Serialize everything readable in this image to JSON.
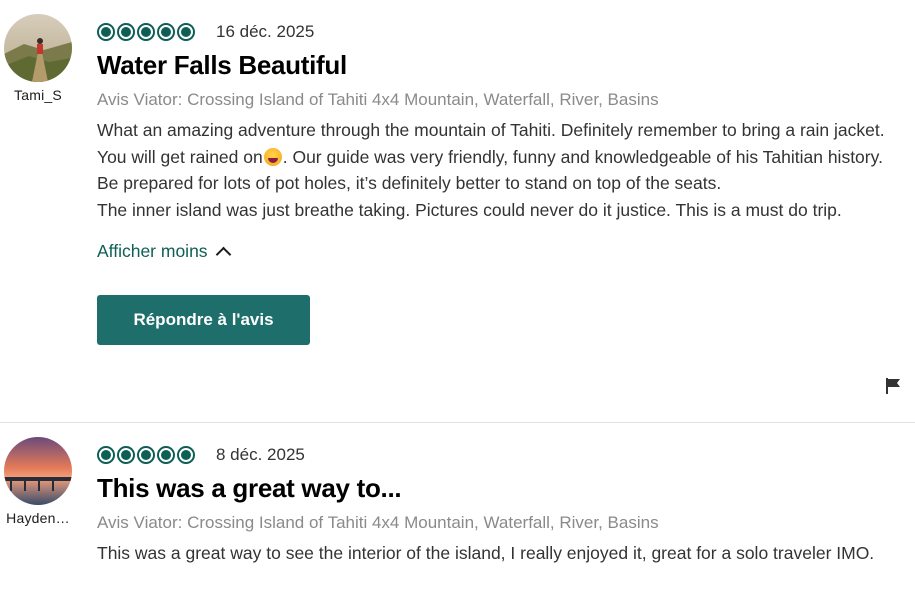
{
  "reviews": [
    {
      "username": "Tami_S",
      "rating": 5,
      "date": "16 déc. 2025",
      "title": "Water Falls Beautiful",
      "source": "Avis Viator: Crossing Island of Tahiti 4x4 Mountain, Waterfall, River, Basins",
      "body_part1": "What an amazing adventure through the mountain of Tahiti. Definitely remember to bring a rain jacket. You will get rained on",
      "body_part2": ". Our guide was very friendly, funny and knowledgeable of his Tahitian history. Be prepared for lots of pot holes, it’s definitely better to stand on top of the seats.",
      "body_part3": "The inner island was just breathe taking. Pictures could never do it justice. This is a must do trip.",
      "show_less_label": "Afficher moins",
      "reply_label": "Répondre à l'avis",
      "emoji_icon": "laughing-crying-emoji",
      "flag_icon": "flag-icon"
    },
    {
      "username": "Hayden…",
      "rating": 5,
      "date": "8 déc. 2025",
      "title": "This was a great way to...",
      "source": "Avis Viator: Crossing Island of Tahiti 4x4 Mountain, Waterfall, River, Basins",
      "body": "This was a great way to see the interior of the island, I really enjoyed it, great for a solo traveler IMO."
    }
  ],
  "colors": {
    "accent": "#0d5f55",
    "button_bg": "#1e6e6c",
    "muted_text": "#8a8a8a"
  }
}
